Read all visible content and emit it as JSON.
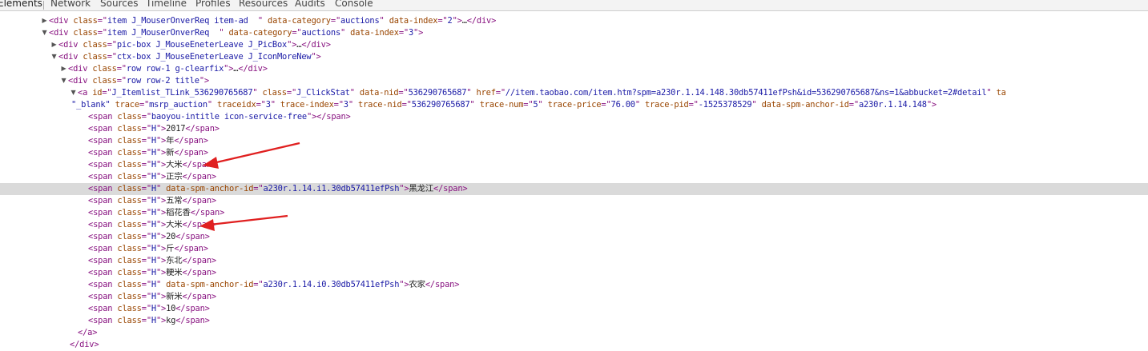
{
  "tabs": [
    "Elements",
    "Network",
    "Sources",
    "Timeline",
    "Profiles",
    "Resources",
    "Audits",
    "Console"
  ],
  "active_tab": "Elements",
  "accent_colors": {
    "tag": "#881280",
    "attr_name": "#994500",
    "attr_value": "#1a1aa6",
    "arrow": "#e02020",
    "highlight": "#dadada"
  },
  "icons": {
    "expanded": "triangle-down-icon",
    "collapsed": "triangle-right-icon"
  },
  "lines": [
    {
      "toggle": "collapsed",
      "frags": [
        [
          "t",
          "<div "
        ],
        [
          "n",
          "class"
        ],
        [
          "t",
          "=\""
        ],
        [
          "v",
          "item J_MouserOnverReq item-ad  "
        ],
        [
          "t",
          "\" "
        ],
        [
          "n",
          "data-category"
        ],
        [
          "t",
          "=\""
        ],
        [
          "v",
          "auctions"
        ],
        [
          "t",
          "\" "
        ],
        [
          "n",
          "data-index"
        ],
        [
          "t",
          "=\""
        ],
        [
          "v",
          "2"
        ],
        [
          "t",
          "\">"
        ],
        [
          "x",
          "…"
        ],
        [
          "t",
          "</div>"
        ]
      ]
    },
    {
      "toggle": "expanded",
      "frags": [
        [
          "t",
          "<div "
        ],
        [
          "n",
          "class"
        ],
        [
          "t",
          "=\""
        ],
        [
          "v",
          "item J_MouserOnverReq  "
        ],
        [
          "t",
          "\" "
        ],
        [
          "n",
          "data-category"
        ],
        [
          "t",
          "=\""
        ],
        [
          "v",
          "auctions"
        ],
        [
          "t",
          "\" "
        ],
        [
          "n",
          "data-index"
        ],
        [
          "t",
          "=\""
        ],
        [
          "v",
          "3"
        ],
        [
          "t",
          "\">"
        ]
      ]
    },
    {
      "toggle": "collapsed",
      "frags": [
        [
          "t",
          "<div "
        ],
        [
          "n",
          "class"
        ],
        [
          "t",
          "=\""
        ],
        [
          "v",
          "pic-box J_MouseEneterLeave J_PicBox"
        ],
        [
          "t",
          "\">"
        ],
        [
          "x",
          "…"
        ],
        [
          "t",
          "</div>"
        ]
      ]
    },
    {
      "toggle": "expanded",
      "frags": [
        [
          "t",
          "<div "
        ],
        [
          "n",
          "class"
        ],
        [
          "t",
          "=\""
        ],
        [
          "v",
          "ctx-box J_MouseEneterLeave J_IconMoreNew"
        ],
        [
          "t",
          "\">"
        ]
      ]
    },
    {
      "toggle": "collapsed",
      "frags": [
        [
          "t",
          "<div "
        ],
        [
          "n",
          "class"
        ],
        [
          "t",
          "=\""
        ],
        [
          "v",
          "row row-1 g-clearfix"
        ],
        [
          "t",
          "\">"
        ],
        [
          "x",
          "…"
        ],
        [
          "t",
          "</div>"
        ]
      ]
    },
    {
      "toggle": "expanded",
      "frags": [
        [
          "t",
          "<div "
        ],
        [
          "n",
          "class"
        ],
        [
          "t",
          "=\""
        ],
        [
          "v",
          "row row-2 title"
        ],
        [
          "t",
          "\">"
        ]
      ]
    },
    {
      "toggle": "expanded",
      "frags": [
        [
          "t",
          "<a "
        ],
        [
          "n",
          "id"
        ],
        [
          "t",
          "=\""
        ],
        [
          "v",
          "J_Itemlist_TLink_536290765687"
        ],
        [
          "t",
          "\" "
        ],
        [
          "n",
          "class"
        ],
        [
          "t",
          "=\""
        ],
        [
          "v",
          "J_ClickStat"
        ],
        [
          "t",
          "\" "
        ],
        [
          "n",
          "data-nid"
        ],
        [
          "t",
          "=\""
        ],
        [
          "v",
          "536290765687"
        ],
        [
          "t",
          "\" "
        ],
        [
          "n",
          "href"
        ],
        [
          "t",
          "=\""
        ],
        [
          "v",
          "//item.taobao.com/item.htm?spm=a230r.1.14.148.30db57411efPsh&id=536290765687&ns=1&abbucket=2#detail"
        ],
        [
          "t",
          "\" "
        ],
        [
          "n",
          "ta"
        ]
      ]
    },
    {
      "toggle": null,
      "frags": [
        [
          "v",
          "\"_blank\""
        ],
        [
          "x",
          " "
        ],
        [
          "n",
          "trace"
        ],
        [
          "t",
          "=\""
        ],
        [
          "v",
          "msrp_auction"
        ],
        [
          "t",
          "\" "
        ],
        [
          "n",
          "traceidx"
        ],
        [
          "t",
          "=\""
        ],
        [
          "v",
          "3"
        ],
        [
          "t",
          "\" "
        ],
        [
          "n",
          "trace-index"
        ],
        [
          "t",
          "=\""
        ],
        [
          "v",
          "3"
        ],
        [
          "t",
          "\" "
        ],
        [
          "n",
          "trace-nid"
        ],
        [
          "t",
          "=\""
        ],
        [
          "v",
          "536290765687"
        ],
        [
          "t",
          "\" "
        ],
        [
          "n",
          "trace-num"
        ],
        [
          "t",
          "=\""
        ],
        [
          "v",
          "5"
        ],
        [
          "t",
          "\" "
        ],
        [
          "n",
          "trace-price"
        ],
        [
          "t",
          "=\""
        ],
        [
          "v",
          "76.00"
        ],
        [
          "t",
          "\" "
        ],
        [
          "n",
          "trace-pid"
        ],
        [
          "t",
          "=\""
        ],
        [
          "v",
          "-1525378529"
        ],
        [
          "t",
          "\" "
        ],
        [
          "n",
          "data-spm-anchor-id"
        ],
        [
          "t",
          "=\""
        ],
        [
          "v",
          "a230r.1.14.148"
        ],
        [
          "t",
          "\">"
        ]
      ]
    },
    {
      "toggle": null,
      "frags": [
        [
          "t",
          "<span "
        ],
        [
          "n",
          "class"
        ],
        [
          "t",
          "=\""
        ],
        [
          "v",
          "baoyou-intitle icon-service-free"
        ],
        [
          "t",
          "\">"
        ],
        [
          "t",
          "</span>"
        ]
      ]
    },
    {
      "toggle": null,
      "frags": [
        [
          "t",
          "<span "
        ],
        [
          "n",
          "class"
        ],
        [
          "t",
          "=\""
        ],
        [
          "v",
          "H"
        ],
        [
          "t",
          "\">"
        ],
        [
          "x",
          "2017"
        ],
        [
          "t",
          "</span>"
        ]
      ]
    },
    {
      "toggle": null,
      "frags": [
        [
          "t",
          "<span "
        ],
        [
          "n",
          "class"
        ],
        [
          "t",
          "=\""
        ],
        [
          "v",
          "H"
        ],
        [
          "t",
          "\">"
        ],
        [
          "x",
          "年"
        ],
        [
          "t",
          "</span>"
        ]
      ]
    },
    {
      "toggle": null,
      "frags": [
        [
          "t",
          "<span "
        ],
        [
          "n",
          "class"
        ],
        [
          "t",
          "=\""
        ],
        [
          "v",
          "H"
        ],
        [
          "t",
          "\">"
        ],
        [
          "x",
          "新"
        ],
        [
          "t",
          "</span>"
        ]
      ]
    },
    {
      "toggle": null,
      "frags": [
        [
          "t",
          "<span "
        ],
        [
          "n",
          "class"
        ],
        [
          "t",
          "=\""
        ],
        [
          "v",
          "H"
        ],
        [
          "t",
          "\">"
        ],
        [
          "x",
          "大米"
        ],
        [
          "t",
          "</span>"
        ]
      ]
    },
    {
      "toggle": null,
      "frags": [
        [
          "t",
          "<span "
        ],
        [
          "n",
          "class"
        ],
        [
          "t",
          "=\""
        ],
        [
          "v",
          "H"
        ],
        [
          "t",
          "\">"
        ],
        [
          "x",
          "正宗"
        ],
        [
          "t",
          "</span>"
        ]
      ]
    },
    {
      "toggle": null,
      "highlight": true,
      "frags": [
        [
          "t",
          "<span "
        ],
        [
          "n",
          "class"
        ],
        [
          "t",
          "=\""
        ],
        [
          "v",
          "H"
        ],
        [
          "t",
          "\" "
        ],
        [
          "n",
          "data-spm-anchor-id"
        ],
        [
          "t",
          "=\""
        ],
        [
          "v",
          "a230r.1.14.i1.30db57411efPsh"
        ],
        [
          "t",
          "\">"
        ],
        [
          "x",
          "黑龙江"
        ],
        [
          "t",
          "</span>"
        ]
      ]
    },
    {
      "toggle": null,
      "frags": [
        [
          "t",
          "<span "
        ],
        [
          "n",
          "class"
        ],
        [
          "t",
          "=\""
        ],
        [
          "v",
          "H"
        ],
        [
          "t",
          "\">"
        ],
        [
          "x",
          "五常"
        ],
        [
          "t",
          "</span>"
        ]
      ]
    },
    {
      "toggle": null,
      "frags": [
        [
          "t",
          "<span "
        ],
        [
          "n",
          "class"
        ],
        [
          "t",
          "=\""
        ],
        [
          "v",
          "H"
        ],
        [
          "t",
          "\">"
        ],
        [
          "x",
          "稻花香"
        ],
        [
          "t",
          "</span>"
        ]
      ]
    },
    {
      "toggle": null,
      "frags": [
        [
          "t",
          "<span "
        ],
        [
          "n",
          "class"
        ],
        [
          "t",
          "=\""
        ],
        [
          "v",
          "H"
        ],
        [
          "t",
          "\">"
        ],
        [
          "x",
          "大米"
        ],
        [
          "t",
          "</span>"
        ]
      ]
    },
    {
      "toggle": null,
      "frags": [
        [
          "t",
          "<span "
        ],
        [
          "n",
          "class"
        ],
        [
          "t",
          "=\""
        ],
        [
          "v",
          "H"
        ],
        [
          "t",
          "\">"
        ],
        [
          "x",
          "20"
        ],
        [
          "t",
          "</span>"
        ]
      ]
    },
    {
      "toggle": null,
      "frags": [
        [
          "t",
          "<span "
        ],
        [
          "n",
          "class"
        ],
        [
          "t",
          "=\""
        ],
        [
          "v",
          "H"
        ],
        [
          "t",
          "\">"
        ],
        [
          "x",
          "斤"
        ],
        [
          "t",
          "</span>"
        ]
      ]
    },
    {
      "toggle": null,
      "frags": [
        [
          "t",
          "<span "
        ],
        [
          "n",
          "class"
        ],
        [
          "t",
          "=\""
        ],
        [
          "v",
          "H"
        ],
        [
          "t",
          "\">"
        ],
        [
          "x",
          "东北"
        ],
        [
          "t",
          "</span>"
        ]
      ]
    },
    {
      "toggle": null,
      "frags": [
        [
          "t",
          "<span "
        ],
        [
          "n",
          "class"
        ],
        [
          "t",
          "=\""
        ],
        [
          "v",
          "H"
        ],
        [
          "t",
          "\">"
        ],
        [
          "x",
          "粳米"
        ],
        [
          "t",
          "</span>"
        ]
      ]
    },
    {
      "toggle": null,
      "frags": [
        [
          "t",
          "<span "
        ],
        [
          "n",
          "class"
        ],
        [
          "t",
          "=\""
        ],
        [
          "v",
          "H"
        ],
        [
          "t",
          "\" "
        ],
        [
          "n",
          "data-spm-anchor-id"
        ],
        [
          "t",
          "=\""
        ],
        [
          "v",
          "a230r.1.14.i0.30db57411efPsh"
        ],
        [
          "t",
          "\">"
        ],
        [
          "x",
          "农家"
        ],
        [
          "t",
          "</span>"
        ]
      ]
    },
    {
      "toggle": null,
      "frags": [
        [
          "t",
          "<span "
        ],
        [
          "n",
          "class"
        ],
        [
          "t",
          "=\""
        ],
        [
          "v",
          "H"
        ],
        [
          "t",
          "\">"
        ],
        [
          "x",
          "新米"
        ],
        [
          "t",
          "</span>"
        ]
      ]
    },
    {
      "toggle": null,
      "frags": [
        [
          "t",
          "<span "
        ],
        [
          "n",
          "class"
        ],
        [
          "t",
          "=\""
        ],
        [
          "v",
          "H"
        ],
        [
          "t",
          "\">"
        ],
        [
          "x",
          "10"
        ],
        [
          "t",
          "</span>"
        ]
      ]
    },
    {
      "toggle": null,
      "frags": [
        [
          "t",
          "<span "
        ],
        [
          "n",
          "class"
        ],
        [
          "t",
          "=\""
        ],
        [
          "v",
          "H"
        ],
        [
          "t",
          "\">"
        ],
        [
          "x",
          "kg"
        ],
        [
          "t",
          "</span>"
        ]
      ]
    },
    {
      "toggle": null,
      "frags": [
        [
          "t",
          "</a>"
        ]
      ]
    },
    {
      "toggle": null,
      "frags": [
        [
          "t",
          "</div>"
        ]
      ]
    }
  ]
}
